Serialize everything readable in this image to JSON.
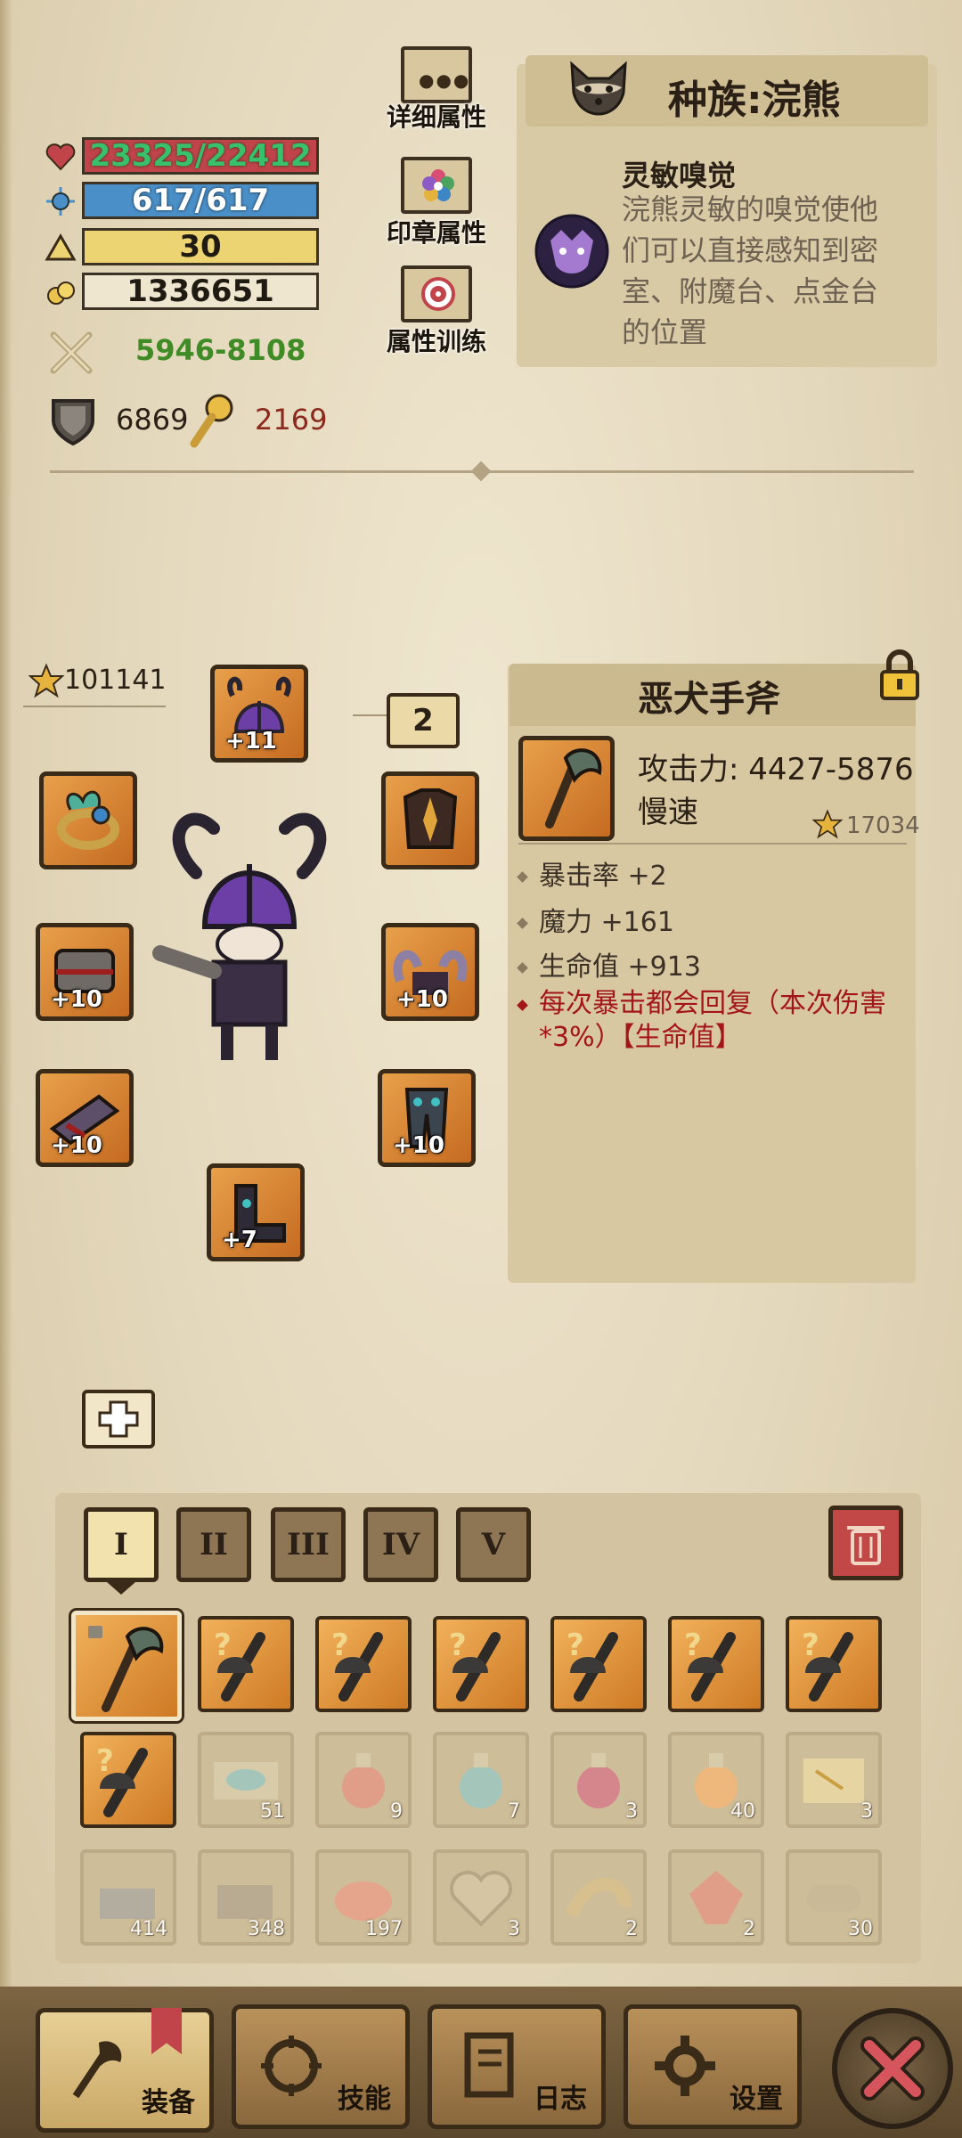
{
  "stats": {
    "hp": "23325/22412",
    "mana": "617/617",
    "level": "30",
    "gold": "1336651",
    "attack": "5946-8108",
    "defense": "6869",
    "magic": "2169"
  },
  "side_buttons": {
    "details": "详细属性",
    "seal": "印章属性",
    "training": "属性训练"
  },
  "race": {
    "title": "种族:浣熊",
    "skill_name": "灵敏嗅觉",
    "skill_desc": "浣熊灵敏的嗅觉使他们可以直接感知到密室、附魔台、点金台的位置"
  },
  "equipment": {
    "power": "101141",
    "page_badge": "2",
    "slots": [
      {
        "name": "helmet",
        "plus": "+11"
      },
      {
        "name": "ring",
        "plus": ""
      },
      {
        "name": "chest",
        "plus": ""
      },
      {
        "name": "weapon",
        "plus": "+10"
      },
      {
        "name": "shoulder",
        "plus": "+10"
      },
      {
        "name": "gloves",
        "plus": "+10"
      },
      {
        "name": "legs",
        "plus": "+10"
      },
      {
        "name": "boots",
        "plus": "+7"
      }
    ]
  },
  "item": {
    "name": "恶犬手斧",
    "attack": "攻击力: 4427-5876",
    "speed": "慢速",
    "score": "17034",
    "props": [
      "暴击率 +2",
      "魔力 +161",
      "生命值 +913"
    ],
    "special": "每次暴击都会回复（本次伤害*3%）【生命值】"
  },
  "inventory": {
    "tabs": [
      "I",
      "II",
      "III",
      "IV",
      "V"
    ],
    "row3_counts": [
      "",
      "51",
      "9",
      "7",
      "3",
      "40",
      "3"
    ],
    "row4_counts": [
      "414",
      "348",
      "197",
      "3",
      "2",
      "2",
      "30"
    ]
  },
  "nav": {
    "equip": "装备",
    "skills": "技能",
    "log": "日志",
    "settings": "设置"
  },
  "colors": {
    "hp_bar": "#c0444a",
    "mana_bar": "#4a8fc7",
    "level_bar": "#ecd472",
    "gold_bar": "#e6dcc3",
    "attack_text": "#3f8b25",
    "magic_text": "#8b2a1c",
    "special_text": "#a3151b"
  }
}
